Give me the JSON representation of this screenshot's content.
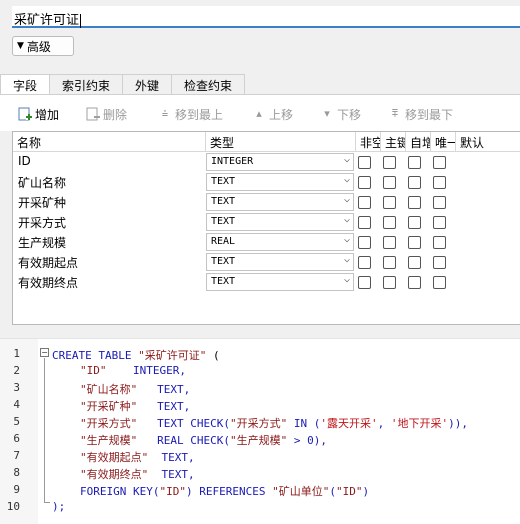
{
  "form": {
    "title_value": "采矿许可证",
    "advanced_label": "高级"
  },
  "tabs": [
    {
      "label": "字段",
      "active": true
    },
    {
      "label": "索引约束",
      "active": false
    },
    {
      "label": "外键",
      "active": false
    },
    {
      "label": "检查约束",
      "active": false
    }
  ],
  "toolbar": {
    "add": "增加",
    "delete": "删除",
    "move_top": "移到最上",
    "move_up": "上移",
    "move_down": "下移",
    "move_bottom": "移到最下"
  },
  "grid": {
    "headers": {
      "name": "名称",
      "type": "类型",
      "notnull": "非空",
      "primary": "主键",
      "autoinc": "自增",
      "unique": "唯一",
      "default": "默认"
    },
    "rows": [
      {
        "name": "ID",
        "type": "INTEGER"
      },
      {
        "name": "矿山名称",
        "type": "TEXT"
      },
      {
        "name": "开采矿种",
        "type": "TEXT"
      },
      {
        "name": "开采方式",
        "type": "TEXT"
      },
      {
        "name": "生产规模",
        "type": "REAL"
      },
      {
        "name": "有效期起点",
        "type": "TEXT"
      },
      {
        "name": "有效期终点",
        "type": "TEXT"
      }
    ]
  },
  "sql": {
    "line_numbers": [
      "1",
      "2",
      "3",
      "4",
      "5",
      "6",
      "7",
      "8",
      "9",
      "10"
    ],
    "l1_kw": "CREATE TABLE",
    "l1_name": "\"采矿许可证\"",
    "l1_paren": " (",
    "l2_col": "\"ID\"",
    "l2_type": "INTEGER,",
    "l3_col": "\"矿山名称\"",
    "l3_type": "TEXT,",
    "l4_col": "\"开采矿种\"",
    "l4_type": "TEXT,",
    "l5_col": "\"开采方式\"",
    "l5_type": "TEXT CHECK(",
    "l5_ref": "\"开采方式\"",
    "l5_in": " IN (",
    "l5_v1": "'露天开采'",
    "l5_comma": ", ",
    "l5_v2": "'地下开采'",
    "l5_end": ")),",
    "l6_col": "\"生产规模\"",
    "l6_type": "REAL CHECK(",
    "l6_ref": "\"生产规模\"",
    "l6_end": " > 0),",
    "l7_col": "\"有效期起点\"",
    "l7_type": "TEXT,",
    "l8_col": "\"有效期终点\"",
    "l8_type": "TEXT,",
    "l9_kw1": "FOREIGN KEY(",
    "l9_ref1": "\"ID\"",
    "l9_kw2": ") REFERENCES ",
    "l9_tbl": "\"矿山单位\"",
    "l9_p1": "(",
    "l9_ref2": "\"ID\"",
    "l9_p2": ")",
    "l10": ");"
  }
}
